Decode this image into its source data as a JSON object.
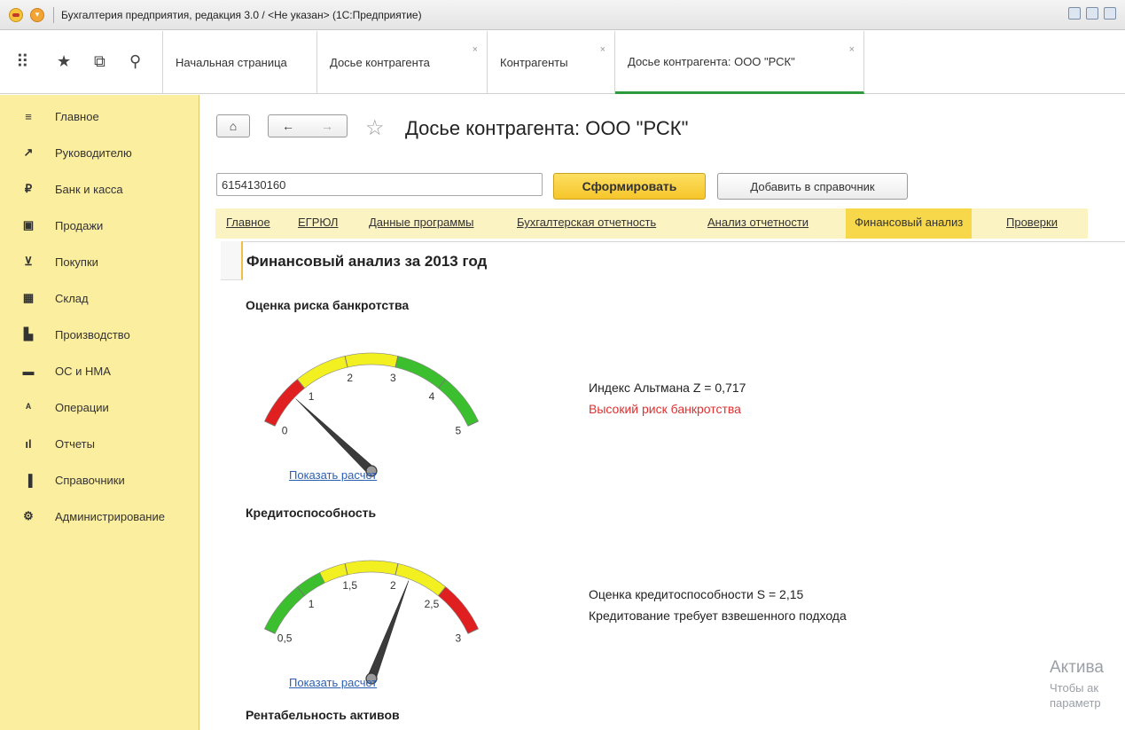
{
  "window": {
    "title": "Бухгалтерия предприятия, редакция 3.0 / <Не указан>  (1С:Предприятие)"
  },
  "tabs": [
    {
      "label": "Начальная страница",
      "closable": false
    },
    {
      "label": "Досье контрагента",
      "closable": true
    },
    {
      "label": "Контрагенты",
      "closable": true
    },
    {
      "label": "Досье контрагента: ООО \"РСК\"",
      "closable": true,
      "active": true
    }
  ],
  "tab_close_glyph": "×",
  "sidebar": {
    "items": [
      {
        "label": "Главное",
        "icon": "menu-icon",
        "glyph": "≡"
      },
      {
        "label": "Руководителю",
        "icon": "trend-icon",
        "glyph": "↗"
      },
      {
        "label": "Банк и касса",
        "icon": "ruble-icon",
        "glyph": "₽"
      },
      {
        "label": "Продажи",
        "icon": "bag-icon",
        "glyph": "▣"
      },
      {
        "label": "Покупки",
        "icon": "cart-icon",
        "glyph": "⊻"
      },
      {
        "label": "Склад",
        "icon": "warehouse-icon",
        "glyph": "▦"
      },
      {
        "label": "Производство",
        "icon": "factory-icon",
        "glyph": "▙"
      },
      {
        "label": "ОС и НМА",
        "icon": "truck-icon",
        "glyph": "▬"
      },
      {
        "label": "Операции",
        "icon": "operations-icon",
        "glyph": "ᴬ"
      },
      {
        "label": "Отчеты",
        "icon": "reports-icon",
        "glyph": "ıl"
      },
      {
        "label": "Справочники",
        "icon": "books-icon",
        "glyph": "▐"
      },
      {
        "label": "Администрирование",
        "icon": "gear-icon",
        "glyph": "⚙"
      }
    ]
  },
  "page": {
    "title": "Досье контрагента: ООО \"РСК\"",
    "inn_value": "6154130160",
    "form_button": "Сформировать",
    "add_button": "Добавить в справочник"
  },
  "section_tabs": [
    "Главное",
    "ЕГРЮЛ",
    "Данные программы",
    "Бухгалтерская отчетность",
    "Анализ отчетности",
    "Финансовый анализ",
    "Проверки"
  ],
  "active_section": "Финансовый анализ",
  "content": {
    "heading": "Финансовый анализ за 2013 год",
    "bankruptcy": {
      "title": "Оценка риска банкротства",
      "index_text": "Индекс Альтмана Z = 0,717",
      "risk_text": "Высокий риск банкротства",
      "link": "Показать расчет",
      "gauge": {
        "min": 0,
        "max": 5,
        "value": 0.717,
        "tick_labels": [
          "0",
          "1",
          "2",
          "3",
          "4",
          "5"
        ],
        "zones": [
          {
            "from": 0,
            "to": 1,
            "color": "#e02020"
          },
          {
            "from": 1,
            "to": 3,
            "color": "#f2f020"
          },
          {
            "from": 3,
            "to": 5,
            "color": "#3cbf2e"
          }
        ]
      }
    },
    "credit": {
      "title": "Кредитоспособность",
      "score_text": "Оценка кредитоспособности S = 2,15",
      "advice_text": "Кредитование требует взвешенного подхода",
      "link": "Показать расчет",
      "gauge": {
        "min": 0.5,
        "max": 3,
        "value": 2.15,
        "tick_labels": [
          "0,5",
          "1",
          "1,5",
          "2",
          "2,5",
          "3"
        ],
        "zones": [
          {
            "from": 0.5,
            "to": 1.25,
            "color": "#3cbf2e"
          },
          {
            "from": 1.25,
            "to": 2.5,
            "color": "#f2f020"
          },
          {
            "from": 2.5,
            "to": 3,
            "color": "#e02020"
          }
        ]
      }
    },
    "next_heading": "Рентабельность активов"
  },
  "watermark": {
    "line1": "Актива",
    "line2": "Чтобы ак",
    "line3": "параметр"
  }
}
